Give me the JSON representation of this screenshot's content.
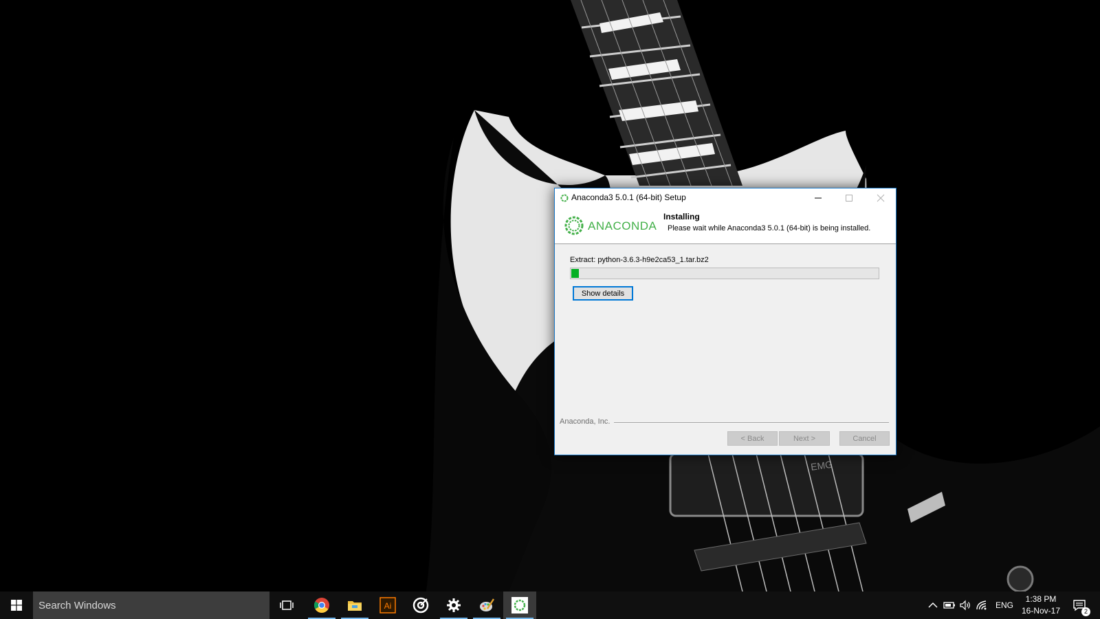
{
  "window": {
    "title": "Anaconda3 5.0.1 (64-bit) Setup",
    "logo_text": "ANACONDA",
    "header_title": "Installing",
    "header_subtitle": "Please wait while Anaconda3 5.0.1 (64-bit) is being installed.",
    "status_text": "Extract: python-3.6.3-h9e2ca53_1.tar.bz2",
    "progress_percent": 2.5,
    "show_details_label": "Show details",
    "brand_text": "Anaconda, Inc.",
    "back_label": "< Back",
    "next_label": "Next >",
    "cancel_label": "Cancel"
  },
  "taskbar": {
    "search_placeholder": "Search Windows",
    "apps": [
      "task-view",
      "chrome",
      "file-explorer",
      "illustrator",
      "target-app",
      "settings",
      "paint",
      "anaconda-setup"
    ],
    "illustrator_label": "Ai",
    "language": "ENG",
    "time": "1:38 PM",
    "date": "16-Nov-17",
    "notification_count": "2"
  },
  "colors": {
    "anaconda_green": "#43b049",
    "progress_green": "#06b025",
    "window_accent": "#1979ca",
    "taskbar_bg": "#101010"
  }
}
